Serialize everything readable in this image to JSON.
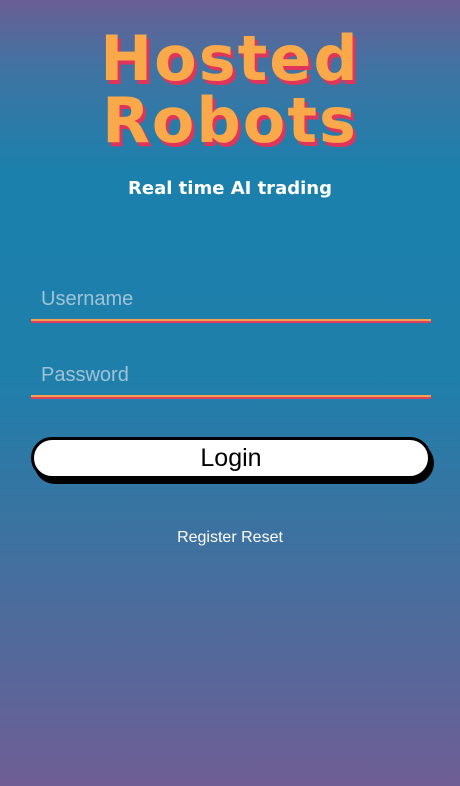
{
  "brand": {
    "line1": "Hosted",
    "line2": "Robots",
    "tagline": "Real time AI trading"
  },
  "form": {
    "username_placeholder": "Username",
    "username_value": "",
    "password_placeholder": "Password",
    "password_value": "",
    "login_label": "Login"
  },
  "links": {
    "register_label": "Register",
    "reset_label": "Reset"
  },
  "colors": {
    "brand_orange": "#f9a84a",
    "brand_red_shadow": "#e0355a",
    "background_top": "#6a5e94",
    "background_mid": "#1b80ac",
    "background_bottom": "#6f5e95"
  }
}
